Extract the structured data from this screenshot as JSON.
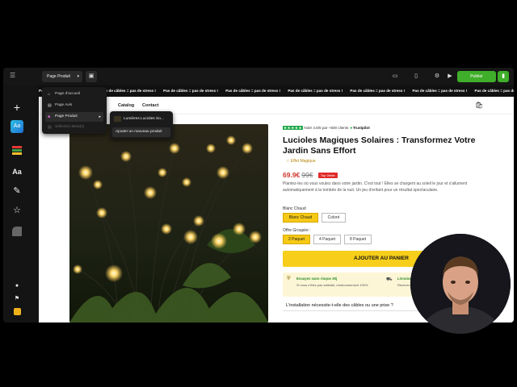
{
  "topbar": {
    "menu_icon": "hamburger-icon",
    "page_select_label": "Page Produit",
    "publish_label": "Publier"
  },
  "dropdown": {
    "items": [
      {
        "label": "Page d'accueil",
        "icon": "home-icon"
      },
      {
        "label": "Page Avis",
        "icon": "page-icon"
      },
      {
        "label": "Page Produit",
        "icon": "product-icon"
      },
      {
        "label": "Sélection Best(s)",
        "icon": "page-icon"
      }
    ]
  },
  "submenu": {
    "item_label": "Lumières Lucioles So...",
    "add_label": "Ajouter un nouveau produit"
  },
  "store": {
    "marquee_text": "Pas de câbles = pas de stress !",
    "nav": [
      "Catalog",
      "Contact"
    ],
    "rating_text": "Noté 4.8/5 par +500 clients",
    "trustpilot": "Trustpilot",
    "title": "Lucioles Magiques Solaires : Transformez Votre Jardin Sans Effort",
    "badge": "Effet Magique",
    "price": "69.9€",
    "old_price": "99€",
    "promo": "Top Vente",
    "description": "Plantez-les où vous voulez dans votre jardin. C'est tout ! Elles se chargent au soleil le jour et s'allument automatiquement à la tombée de la nuit. Un jeu d'enfant pour un résultat spectaculaire.",
    "color_label": "Blanc Chaud",
    "colors": [
      "Blanc Chaud",
      "Coloré"
    ],
    "offer_label": "Offre Groupée :",
    "offers": [
      "2 Paquet",
      "4 Paquet",
      "8 Paquet"
    ],
    "cta": "AJOUTER AU PANIER",
    "guarantee_title": "Essayez sans risque 30j",
    "guarantee_text": "Si vous n'êtes pas satisfait, remboursement 100%",
    "shipping_title": "Livraison",
    "shipping_text": "Recevez",
    "faq": "L'installation nécessite-t-elle des câbles ou une prise ?"
  },
  "colors": {
    "accent": "#f7ce1a",
    "publish": "#3fae2a",
    "price": "#d0342c",
    "trustpilot": "#20a94c"
  }
}
